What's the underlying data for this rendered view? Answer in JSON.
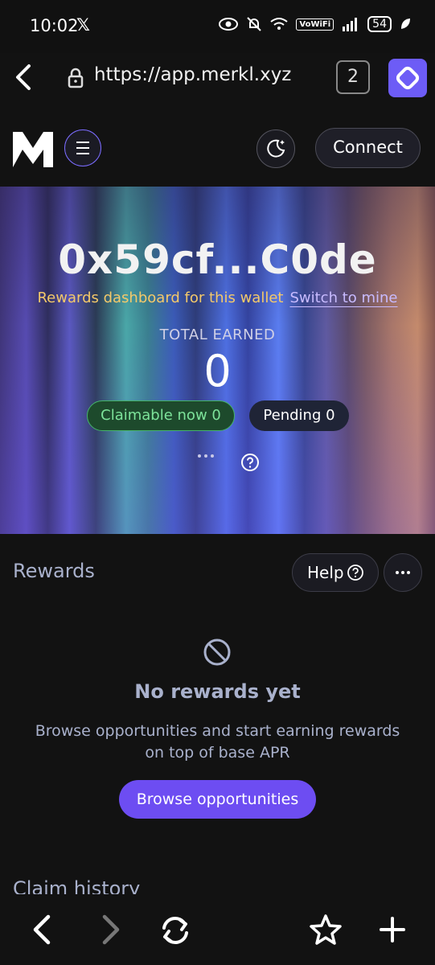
{
  "status_bar": {
    "time": "10:02",
    "battery": "54",
    "vowifi": "VoWiFi"
  },
  "browser": {
    "url": "https://app.merkl.xyz",
    "tab_count": "2"
  },
  "header": {
    "connect_label": "Connect"
  },
  "hero": {
    "wallet_address": "0x59cf...C0de",
    "dashboard_note": "Rewards dashboard for this wallet",
    "switch_label": "Switch to mine",
    "total_label": "TOTAL EARNED",
    "total_value": "0",
    "claimable_label": "Claimable now 0",
    "pending_label": "Pending 0"
  },
  "rewards": {
    "title": "Rewards",
    "help_label": "Help",
    "empty_title": "No rewards yet",
    "empty_desc": "Browse opportunities and start earning rewards on top of base APR",
    "browse_label": "Browse opportunities"
  },
  "claim_history": {
    "title": "Claim history"
  },
  "colors": {
    "accent": "#6d4df2",
    "claimable_green": "#7de39a",
    "note_yellow": "#f4c96a",
    "muted_text": "#a9b1cc"
  }
}
